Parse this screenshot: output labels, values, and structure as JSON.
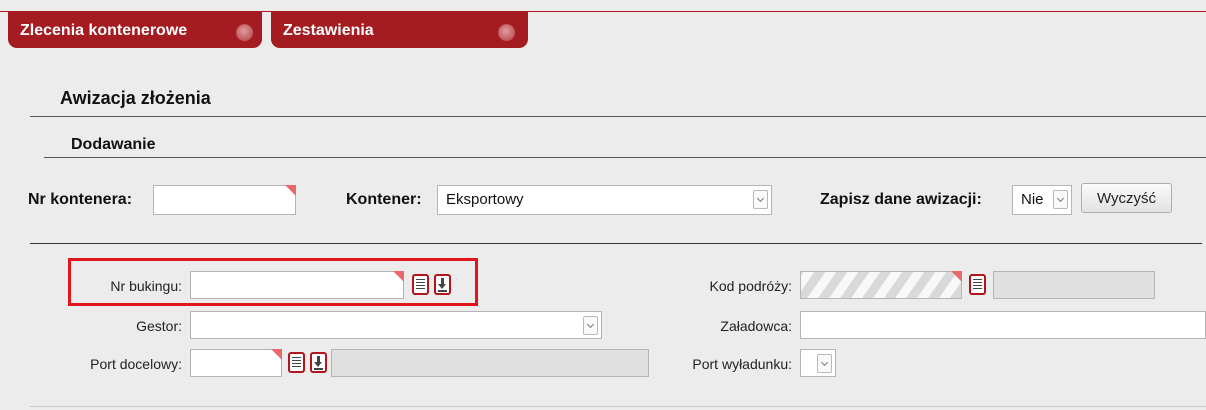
{
  "tabs": [
    {
      "label": "Zlecenia kontenerowe",
      "icon": "close-circle-icon"
    },
    {
      "label": "Zestawienia",
      "icon": "close-circle-icon"
    }
  ],
  "page_title": "Awizacja złożenia",
  "subsection_title": "Dodawanie",
  "top_form": {
    "container_number_label": "Nr kontenera:",
    "container_number_value": "",
    "container_label": "Kontener:",
    "container_value": "Eksportowy",
    "save_data_label": "Zapisz dane awizacji:",
    "save_data_value": "Nie",
    "clear_button": "Wyczyść"
  },
  "fields": {
    "booking_label": "Nr bukingu:",
    "booking_value": "",
    "gestor_label": "Gestor:",
    "gestor_value": "",
    "destination_port_label": "Port docelowy:",
    "destination_port_value": "",
    "trip_code_label": "Kod podróży:",
    "loader_label": "Załadowca:",
    "loader_value": "",
    "unloading_port_label": "Port wyładunku:",
    "unloading_port_value": ""
  },
  "colors": {
    "accent": "#a41b21",
    "highlight": "#e3151c",
    "background": "#ececec"
  }
}
